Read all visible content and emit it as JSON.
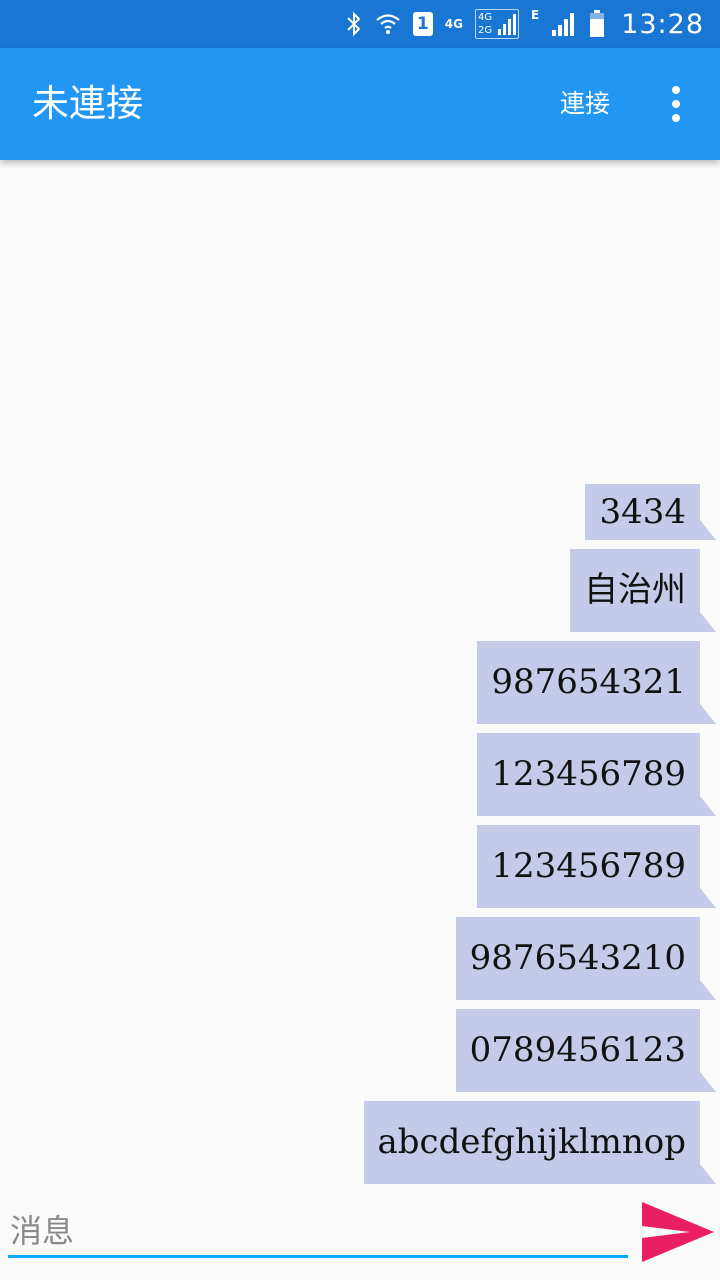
{
  "status_bar": {
    "sim_slot": "1",
    "network_primary": "4G",
    "dual_network_top": "4G",
    "dual_network_bottom": "2G",
    "network_secondary": "E",
    "time": "13:28",
    "icons": [
      "bluetooth-icon",
      "wifi-icon",
      "sim-icon",
      "signal-icon",
      "battery-icon"
    ]
  },
  "app_bar": {
    "title": "未連接",
    "connect_label": "連接",
    "overflow_icon": "more-vert-icon",
    "color": "#2196f3"
  },
  "messages": [
    {
      "text": "3434"
    },
    {
      "text": "自治州"
    },
    {
      "text": "987654321"
    },
    {
      "text": "123456789"
    },
    {
      "text": "123456789"
    },
    {
      "text": "9876543210"
    },
    {
      "text": "0789456123"
    },
    {
      "text": "abcdefghijklmnop"
    }
  ],
  "composer": {
    "placeholder": "消息",
    "value": "",
    "send_icon": "send-icon",
    "send_color": "#e91e63"
  }
}
